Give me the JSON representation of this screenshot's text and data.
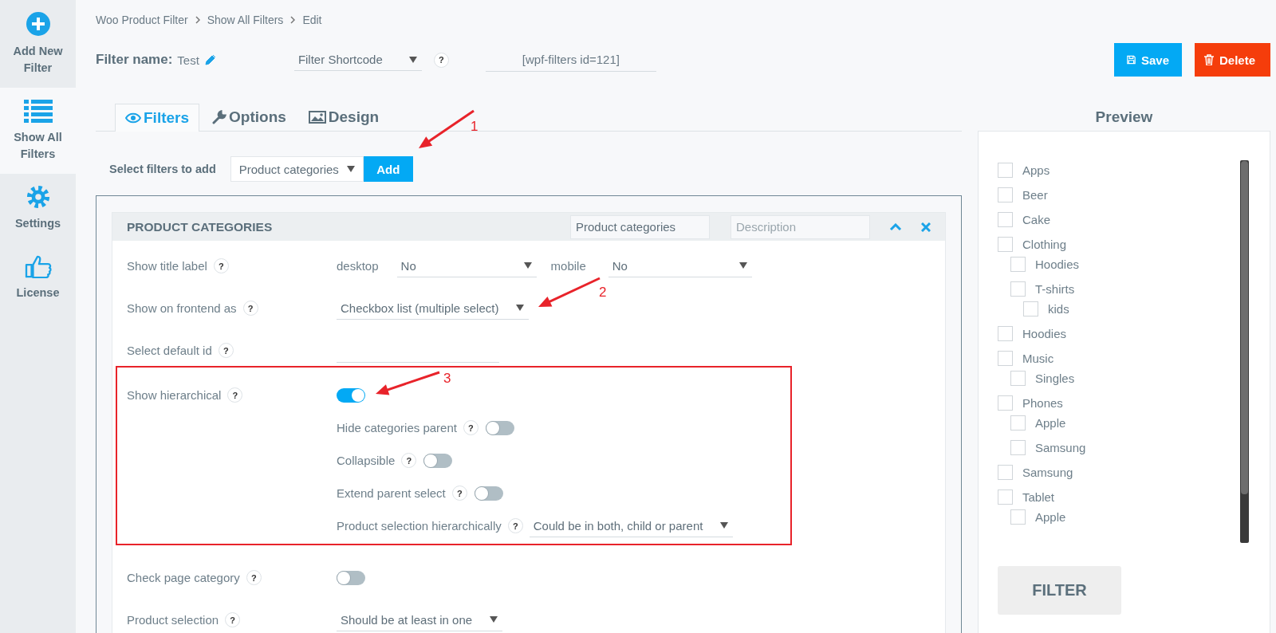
{
  "sidebar": {
    "items": [
      {
        "label": "Add New Filter",
        "selected": false
      },
      {
        "label": "Show All Filters",
        "selected": true
      },
      {
        "label": "Settings",
        "selected": false
      },
      {
        "label": "License",
        "selected": false
      }
    ]
  },
  "breadcrumb": [
    "Woo Product Filter",
    "Show All Filters",
    "Edit"
  ],
  "header": {
    "name_label": "Filter name:",
    "name": "Test",
    "shortcode_select": "Filter Shortcode",
    "help": "?",
    "shortcode": "[wpf-filters id=121]",
    "save": "Save",
    "delete": "Delete"
  },
  "tabs": [
    {
      "label": "Filters",
      "selected": true
    },
    {
      "label": "Options",
      "selected": false
    },
    {
      "label": "Design",
      "selected": false
    }
  ],
  "add_row": {
    "label": "Select filters to add",
    "select": "Product categories",
    "button": "Add"
  },
  "panel": {
    "title": "PRODUCT CATEGORIES",
    "title_field": "Product categories",
    "description_placeholder": "Description"
  },
  "rows": [
    {
      "kind": "dual_select",
      "label": "Show title label",
      "help": "?",
      "first_label": "desktop",
      "first_value": "No",
      "second_label": "mobile",
      "second_value": "No",
      "highlighted": false
    },
    {
      "kind": "select",
      "label": "Show on frontend as",
      "help": "?",
      "value": "Checkbox list (multiple select)",
      "highlighted": false
    },
    {
      "kind": "input",
      "label": "Select default id",
      "help": "?",
      "highlighted": false
    },
    {
      "kind": "toggle",
      "label": "Show hierarchical",
      "help": "?",
      "on": true,
      "highlighted": true,
      "sub_options": [
        {
          "kind": "toggle",
          "label": "Hide categories parent",
          "help": "?",
          "on": false
        },
        {
          "kind": "toggle",
          "label": "Collapsible",
          "help": "?",
          "on": false
        },
        {
          "kind": "toggle",
          "label": "Extend parent select",
          "help": "?",
          "on": false
        },
        {
          "kind": "select",
          "label": "Product selection hierarchically",
          "help": "?",
          "value": "Could be in both, child or parent"
        }
      ]
    },
    {
      "kind": "toggle",
      "label": "Check page category",
      "help": "?",
      "on": false,
      "highlighted": false
    },
    {
      "kind": "select",
      "label": "Product selection",
      "help": "?",
      "value": "Should be at least in one",
      "highlighted": false
    }
  ],
  "preview": {
    "title": "Preview",
    "button": "FILTER",
    "items": [
      {
        "label": "Apps",
        "checked": false
      },
      {
        "label": "Beer",
        "checked": false
      },
      {
        "label": "Cake",
        "checked": false
      },
      {
        "label": "Clothing",
        "checked": false,
        "children": [
          {
            "label": "Hoodies",
            "checked": false
          },
          {
            "label": "T-shirts",
            "checked": false,
            "children": [
              {
                "label": "kids",
                "checked": false
              }
            ]
          }
        ]
      },
      {
        "label": "Hoodies",
        "checked": false
      },
      {
        "label": "Music",
        "checked": false,
        "children": [
          {
            "label": "Singles",
            "checked": false
          }
        ]
      },
      {
        "label": "Phones",
        "checked": false,
        "children": [
          {
            "label": "Apple",
            "checked": false
          },
          {
            "label": "Samsung",
            "checked": false
          }
        ]
      },
      {
        "label": "Samsung",
        "checked": false
      },
      {
        "label": "Tablet",
        "checked": false,
        "children": [
          {
            "label": "Apple",
            "checked": false
          }
        ]
      }
    ]
  },
  "annotations": [
    {
      "label": "1"
    },
    {
      "label": "2"
    },
    {
      "label": "3"
    }
  ]
}
